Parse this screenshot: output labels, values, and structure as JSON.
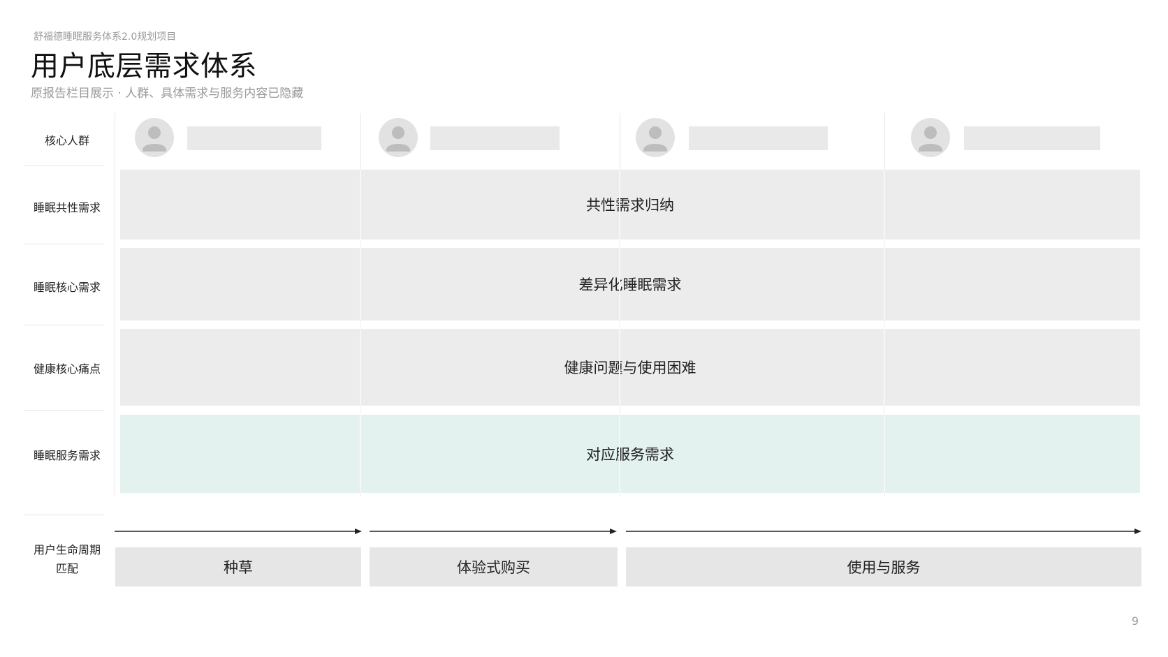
{
  "header": {
    "project": "舒福德睡眠服务体系2.0规划项目",
    "title": "用户底层需求体系",
    "subtitle": "原报告栏目展示 · 人群、具体需求与服务内容已隐藏"
  },
  "rows": {
    "persona": "核心人群",
    "common": "睡眠共性需求",
    "core": "睡眠核心需求",
    "pain": "健康核心痛点",
    "service": "睡眠服务需求",
    "lifecycle_line1": "用户生命周期",
    "lifecycle_line2": "匹配"
  },
  "personas": [
    {
      "icon": "user-avatar-icon"
    },
    {
      "icon": "user-avatar-icon"
    },
    {
      "icon": "user-avatar-icon"
    },
    {
      "icon": "user-avatar-icon"
    }
  ],
  "bands": {
    "common": "共性需求归纳",
    "core": "差异化睡眠需求",
    "pain": "健康问题与使用困难",
    "service": "对应服务需求"
  },
  "lifecycle": {
    "stages": [
      "种草",
      "体验式购买",
      "使用与服务"
    ]
  },
  "colors": {
    "band": "#ececec",
    "service_band": "#e3f2ef",
    "stage": "#e6e6e6",
    "muted_text": "#9a9a9a"
  },
  "page_number": "9"
}
